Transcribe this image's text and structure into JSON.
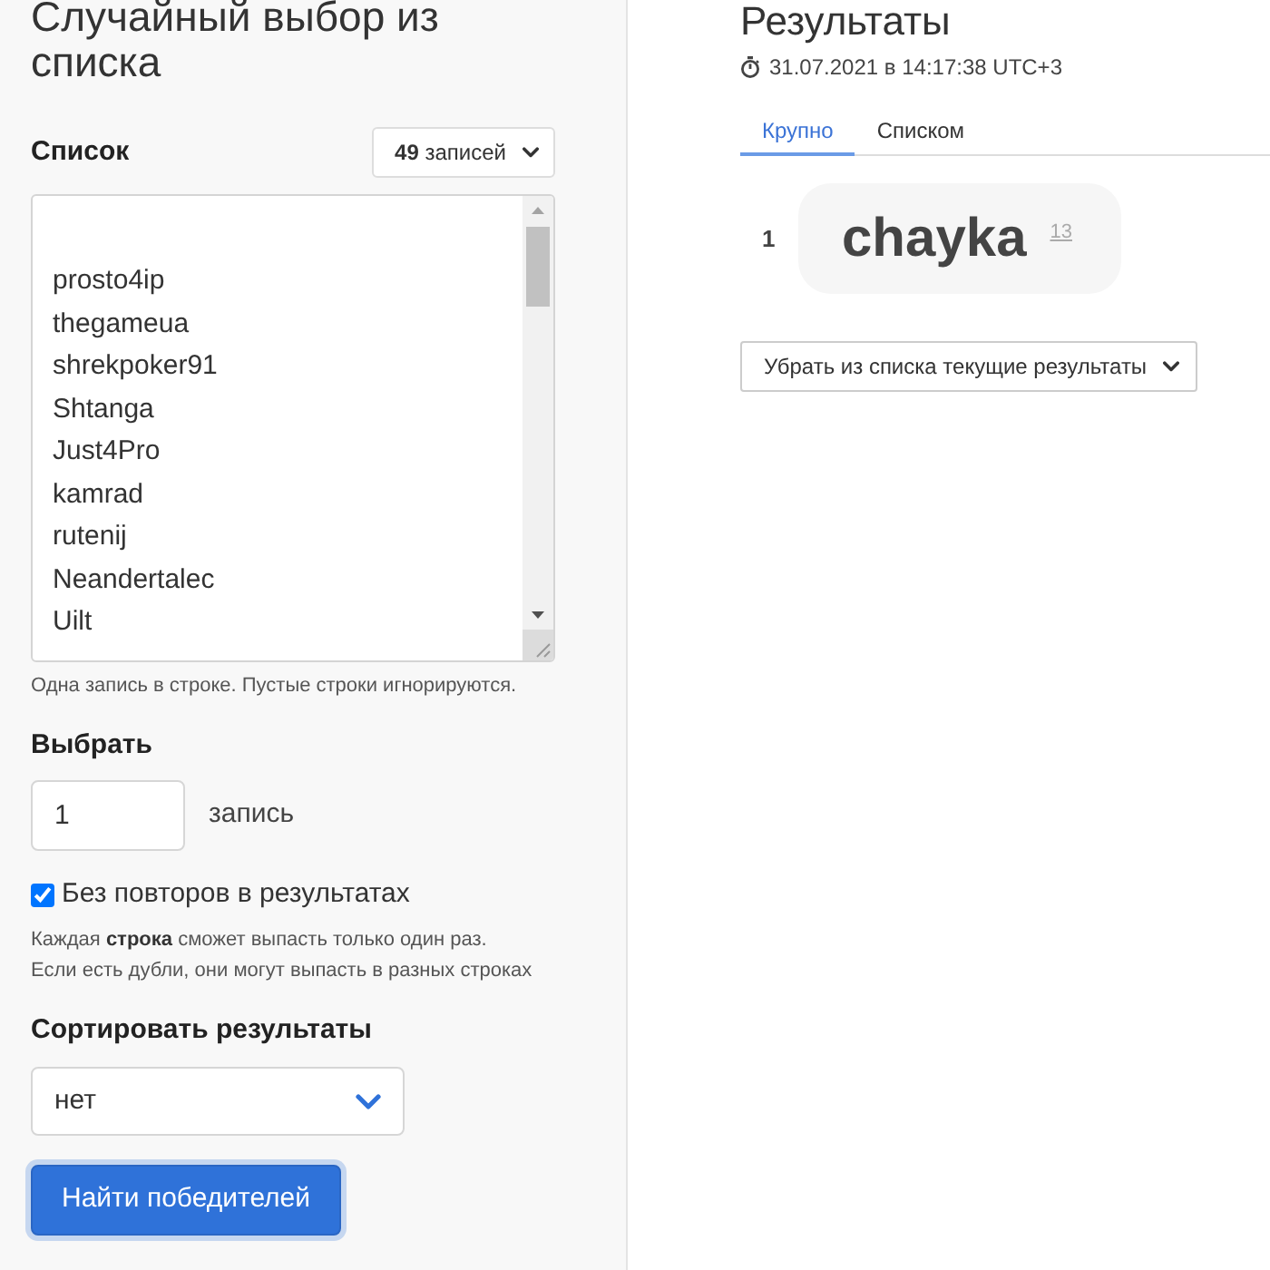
{
  "form": {
    "title": "Случайный выбор из списка",
    "list": {
      "label": "Список",
      "count_button": "**49** записей",
      "lines": [
        "prosto4ip",
        "thegameua",
        "shrekpoker91",
        "Shtanga",
        "Just4Pro",
        "kamrad",
        "rutenij",
        "Neandertalec",
        "Uilt"
      ],
      "hint": "Одна запись в строке. Пустые строки игнорируются."
    },
    "pick": {
      "label": "Выбрать",
      "value": "1",
      "unit": "запись"
    },
    "no_repeats": {
      "label": "Без повторов в результатах",
      "checked": true,
      "help": [
        "Каждая **строка** сможет выпасть только один раз.",
        "Если есть дубли, они могут выпасть в разных строках"
      ]
    },
    "sort": {
      "label": "Сортировать результаты",
      "value": "нет"
    },
    "submit_button": "Найти победителей"
  },
  "results": {
    "title": "Результаты",
    "timestamp": "31.07.2021 в 14:17:38 UTC+3",
    "tabs": [
      {
        "label": "Крупно",
        "selected": true
      },
      {
        "label": "Списком",
        "selected": false
      }
    ],
    "winners": [
      {
        "rank": "1",
        "name": "chayka",
        "line_number": "13"
      }
    ],
    "remove_button": "Убрать из списка текущие результаты"
  }
}
